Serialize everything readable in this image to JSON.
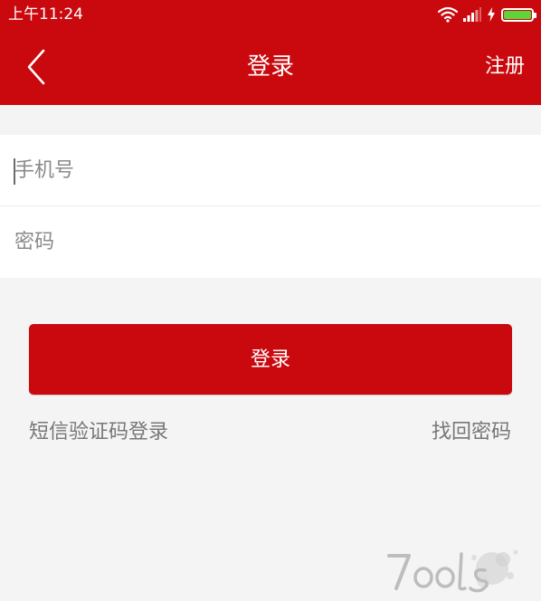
{
  "status_bar": {
    "time": "上午11:24",
    "icons": [
      "wifi-icon",
      "signal-icon",
      "charging-icon",
      "battery-icon"
    ],
    "battery_color": "#5fd43a"
  },
  "header": {
    "back_icon": "chevron-left-icon",
    "title": "登录",
    "register_label": "注册",
    "background_color": "#c9090e"
  },
  "form": {
    "phone": {
      "value": "",
      "placeholder": "手机号"
    },
    "password": {
      "value": "",
      "placeholder": "密码"
    }
  },
  "actions": {
    "login_label": "登录",
    "sms_login_label": "短信验证码登录",
    "forgot_password_label": "找回密码"
  },
  "watermark": {
    "text": "7ools"
  }
}
